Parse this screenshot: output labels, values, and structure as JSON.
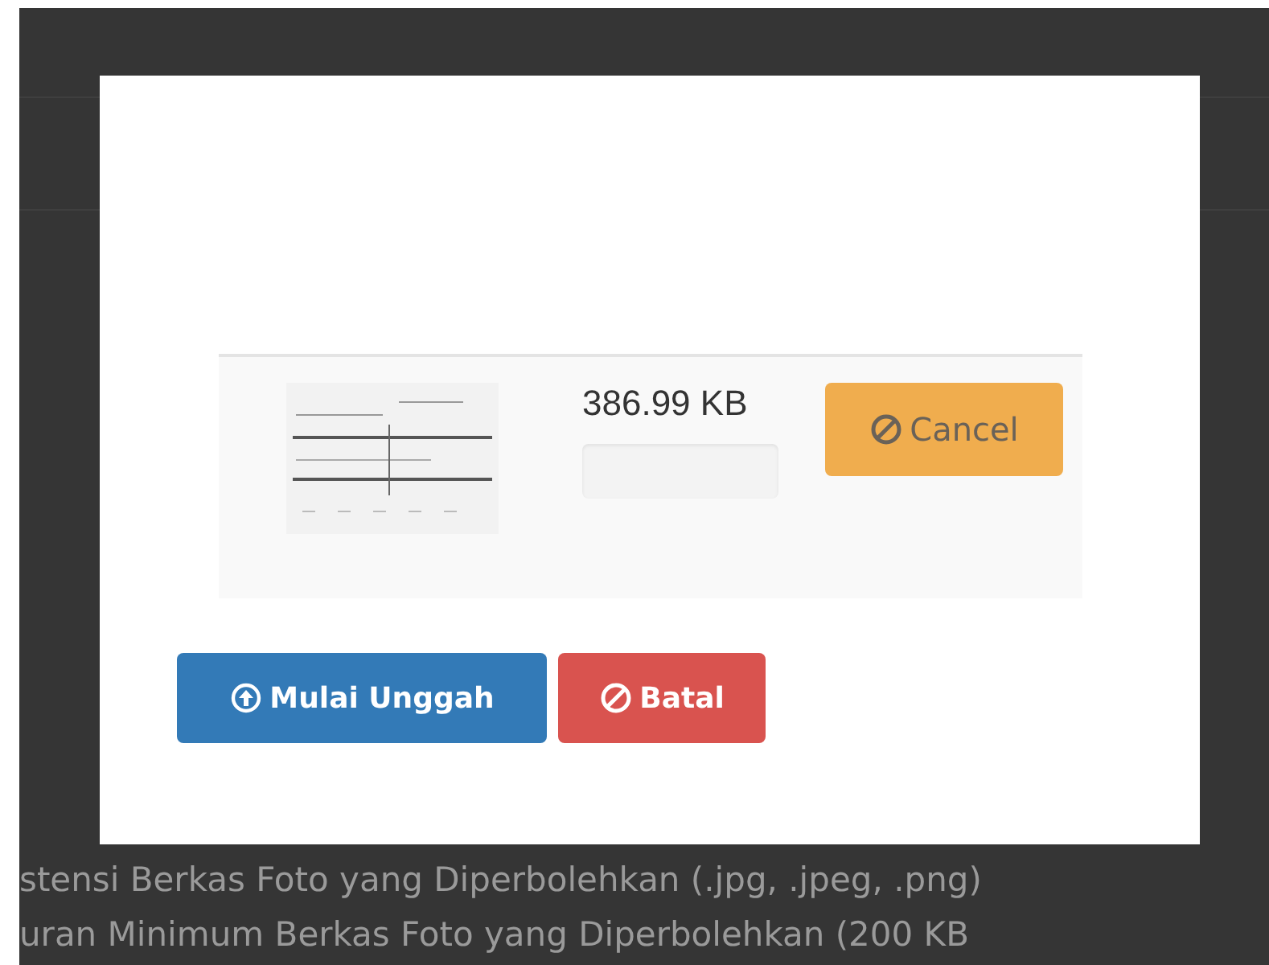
{
  "dialog": {
    "file": {
      "size": "386.99 KB",
      "progress": {
        "level": 0
      },
      "cancel_button": "Cancel"
    },
    "buttons": [
      {
        "label": "Mulai Unggah",
        "kind": "primary"
      },
      {
        "label": "Batal",
        "kind": "danger"
      }
    ]
  },
  "background_text": [
    "stensi Berkas Foto yang Diperbolehkan (.jpg, .jpeg, .png)",
    "uran Minimum Berkas Foto yang Diperbolehkan (200 KB"
  ]
}
